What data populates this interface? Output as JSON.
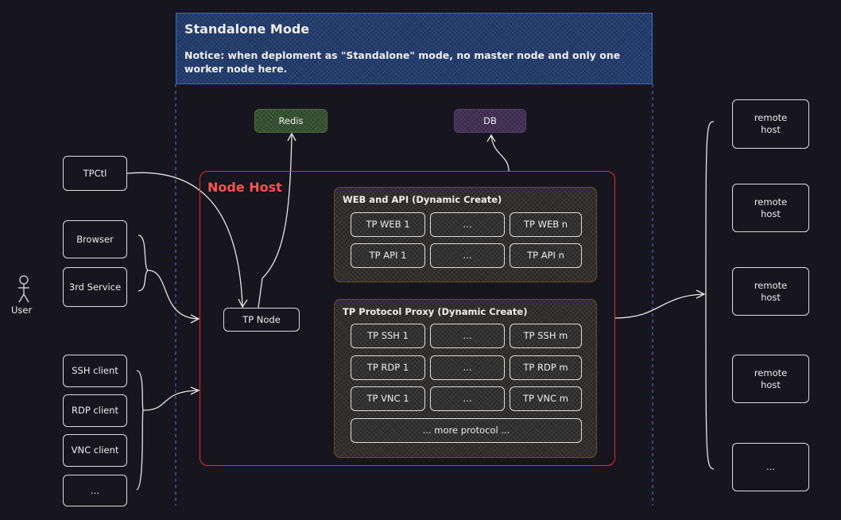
{
  "header": {
    "title": "Standalone Mode",
    "notice": "Notice: when deploment as \"Standalone\" mode, no master node and only one worker node here."
  },
  "stores": {
    "redis": "Redis",
    "db": "DB"
  },
  "node_host": {
    "title": "Node Host",
    "tp_node": "TP Node"
  },
  "web_api": {
    "title": "WEB and API (Dynamic Create)",
    "rows": [
      [
        "TP WEB 1",
        "...",
        "TP WEB n"
      ],
      [
        "TP API 1",
        "...",
        "TP API n"
      ]
    ]
  },
  "proxy": {
    "title": "TP Protocol Proxy (Dynamic Create)",
    "rows": [
      [
        "TP SSH 1",
        "...",
        "TP SSH m"
      ],
      [
        "TP RDP 1",
        "...",
        "TP RDP m"
      ],
      [
        "TP VNC 1",
        "...",
        "TP VNC m"
      ]
    ],
    "more": "... more protocol ..."
  },
  "clients": {
    "tpctl": "TPCtl",
    "browser": "Browser",
    "third": "3rd Service",
    "ssh": "SSH client",
    "rdp": "RDP client",
    "vnc": "VNC client",
    "more": "..."
  },
  "user": {
    "label": "User",
    "icon": "stick-figure-icon"
  },
  "remote": [
    "remote host",
    "remote host",
    "remote host",
    "remote host",
    "..."
  ],
  "colors": {
    "header": "#1d3666",
    "redis": "#2f4a2a",
    "db": "#3b2a4d",
    "node_host_border": "#e03131",
    "group_border": "#6a5010"
  }
}
